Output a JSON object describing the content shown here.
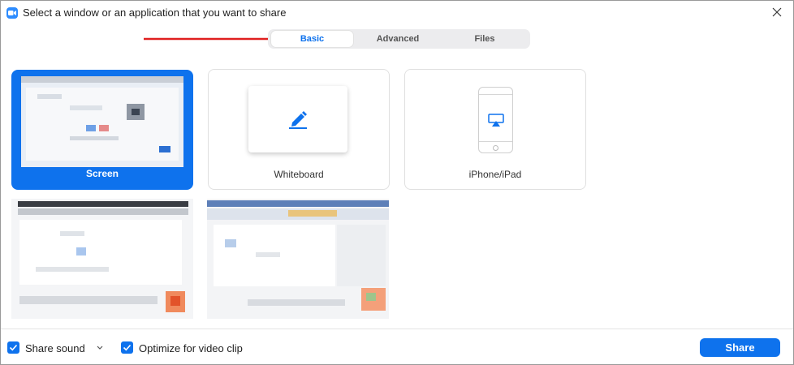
{
  "window": {
    "title": "Select a window or an application that you want to share",
    "app_icon": "zoom-camera-icon",
    "close_icon": "close-icon"
  },
  "tabs": [
    {
      "label": "Basic",
      "active": true
    },
    {
      "label": "Advanced",
      "active": false
    },
    {
      "label": "Files",
      "active": false
    }
  ],
  "annotation": {
    "arrow_color": "#e02020",
    "arrow_icon": "red-arrow-pointer"
  },
  "options": [
    {
      "label": "Screen",
      "selected": true,
      "icon": "desktop-thumbnail"
    },
    {
      "label": "Whiteboard",
      "selected": false,
      "icon": "pen-icon"
    },
    {
      "label": "iPhone/iPad",
      "selected": false,
      "icon": "airplay-icon"
    }
  ],
  "windows": [
    {
      "thumbnail": "blurred-window-thumbnail"
    },
    {
      "thumbnail": "blurred-window-thumbnail"
    }
  ],
  "footer": {
    "share_sound": {
      "label": "Share sound",
      "checked": true
    },
    "optimize_video": {
      "label": "Optimize for video clip",
      "checked": true
    },
    "share_button": "Share"
  },
  "colors": {
    "accent": "#0e72ed",
    "tab_bg": "#ececee",
    "border": "#e0e0e0"
  }
}
